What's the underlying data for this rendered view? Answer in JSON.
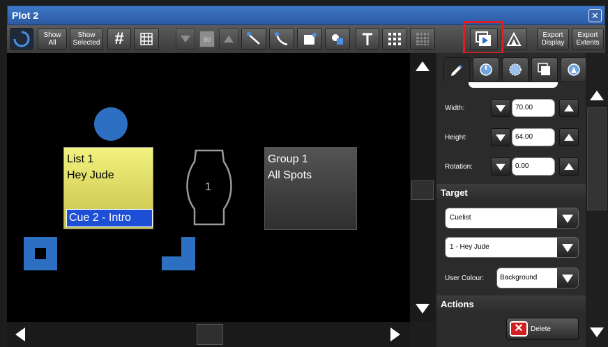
{
  "window": {
    "title": "Plot 2",
    "close_icon": "close-icon"
  },
  "toolbar": {
    "show_all": [
      "Show",
      "All"
    ],
    "show_selected": [
      "Show",
      "Selected"
    ],
    "zoom_value": "80",
    "export_display": [
      "Export",
      "Display"
    ],
    "export_extents": [
      "Export",
      "Extents"
    ]
  },
  "canvas": {
    "list_box": {
      "title": "List 1",
      "subtitle": "Hey Jude",
      "cue": "Cue 2 - Intro",
      "bg": "#dede5a",
      "cue_bg": "#1d4fd6"
    },
    "fixture": {
      "number": "1"
    },
    "group_box": {
      "title": "Group 1",
      "subtitle": "All Spots"
    },
    "accent": "#2d6fc1"
  },
  "panel": {
    "width": {
      "label": "Width:",
      "value": "70.00"
    },
    "height": {
      "label": "Height:",
      "value": "64.00"
    },
    "rotation": {
      "label": "Rotation:",
      "value": "0.00"
    },
    "target_header": "Target",
    "target_type": "Cuelist",
    "target_item": "1 - Hey Jude",
    "user_colour": {
      "label": "User Colour:",
      "value": "Background"
    },
    "actions_header": "Actions",
    "delete_label": "Delete"
  }
}
